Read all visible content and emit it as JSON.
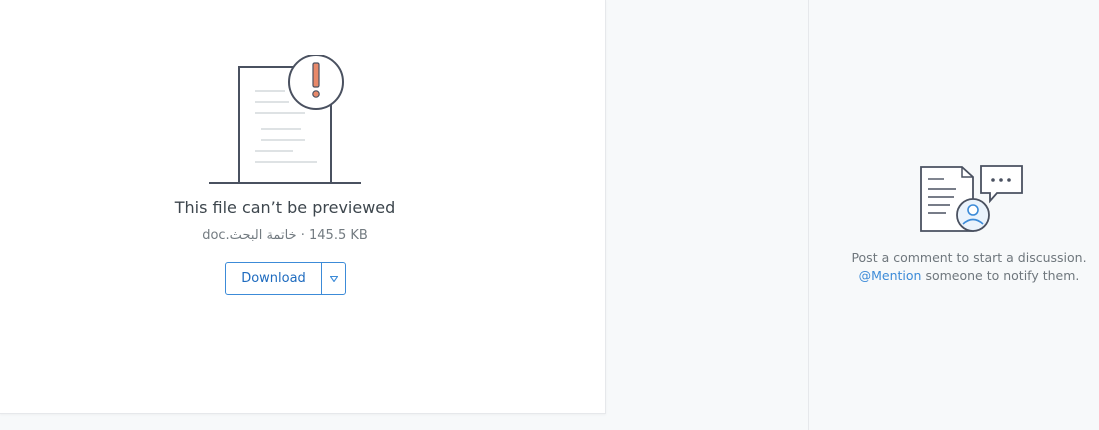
{
  "preview": {
    "title": "This file can’t be previewed",
    "file_name": "خاتمة البحث.doc",
    "separator": "·",
    "file_size": "145.5 KB",
    "download_label": "Download",
    "caret_icon": "triangle-down-icon"
  },
  "comments": {
    "hint_line1": "Post a comment to start a discussion.",
    "mention_link": "@Mention",
    "hint_line2_rest": "someone to notify them."
  },
  "colors": {
    "accent": "#3c8bd8",
    "warning": "#e8896a",
    "illustration_stroke": "#4a5160"
  }
}
